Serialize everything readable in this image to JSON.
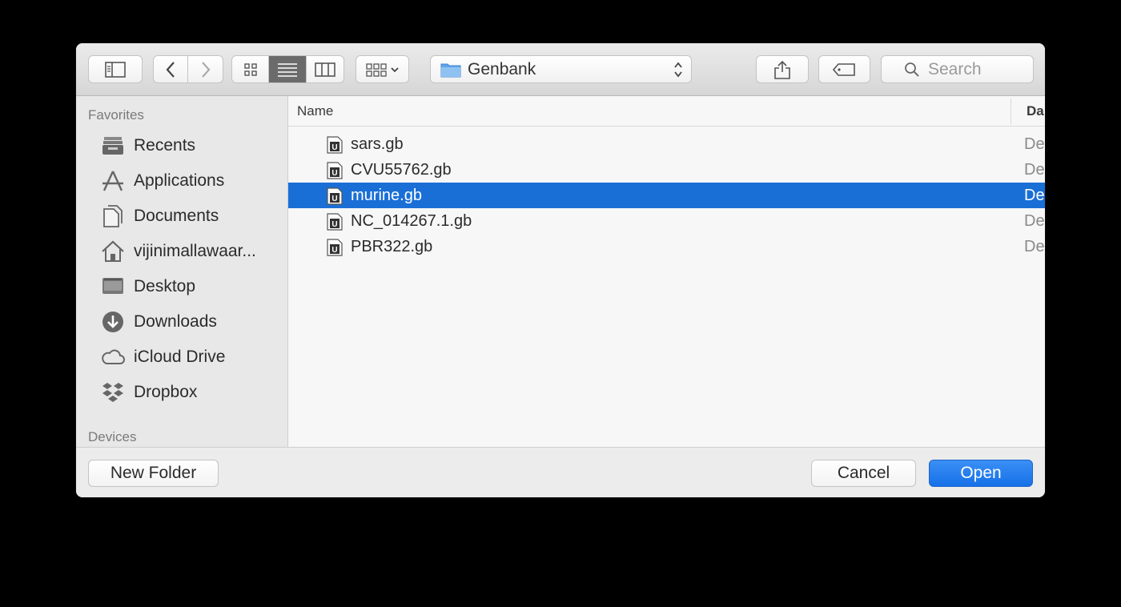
{
  "toolbar": {
    "path_folder": "Genbank",
    "search_placeholder": "Search"
  },
  "sidebar": {
    "favorites_header": "Favorites",
    "devices_header": "Devices",
    "items": [
      {
        "label": "Recents",
        "icon": "recents-icon"
      },
      {
        "label": "Applications",
        "icon": "applications-icon"
      },
      {
        "label": "Documents",
        "icon": "documents-icon"
      },
      {
        "label": "vijinimallawaar...",
        "icon": "home-icon"
      },
      {
        "label": "Desktop",
        "icon": "desktop-icon"
      },
      {
        "label": "Downloads",
        "icon": "downloads-icon"
      },
      {
        "label": "iCloud Drive",
        "icon": "icloud-icon"
      },
      {
        "label": "Dropbox",
        "icon": "dropbox-icon"
      }
    ]
  },
  "filelist": {
    "column_name": "Name",
    "column_date": "Da",
    "files": [
      {
        "name": "sars.gb",
        "date": "De",
        "selected": false
      },
      {
        "name": "CVU55762.gb",
        "date": "De",
        "selected": false
      },
      {
        "name": "murine.gb",
        "date": "De",
        "selected": true
      },
      {
        "name": "NC_014267.1.gb",
        "date": "De",
        "selected": false
      },
      {
        "name": "PBR322.gb",
        "date": "De",
        "selected": false
      }
    ]
  },
  "footer": {
    "new_folder_label": "New Folder",
    "cancel_label": "Cancel",
    "open_label": "Open"
  },
  "colors": {
    "selection": "#1a6fd6",
    "primary_button": "#1571e8"
  }
}
